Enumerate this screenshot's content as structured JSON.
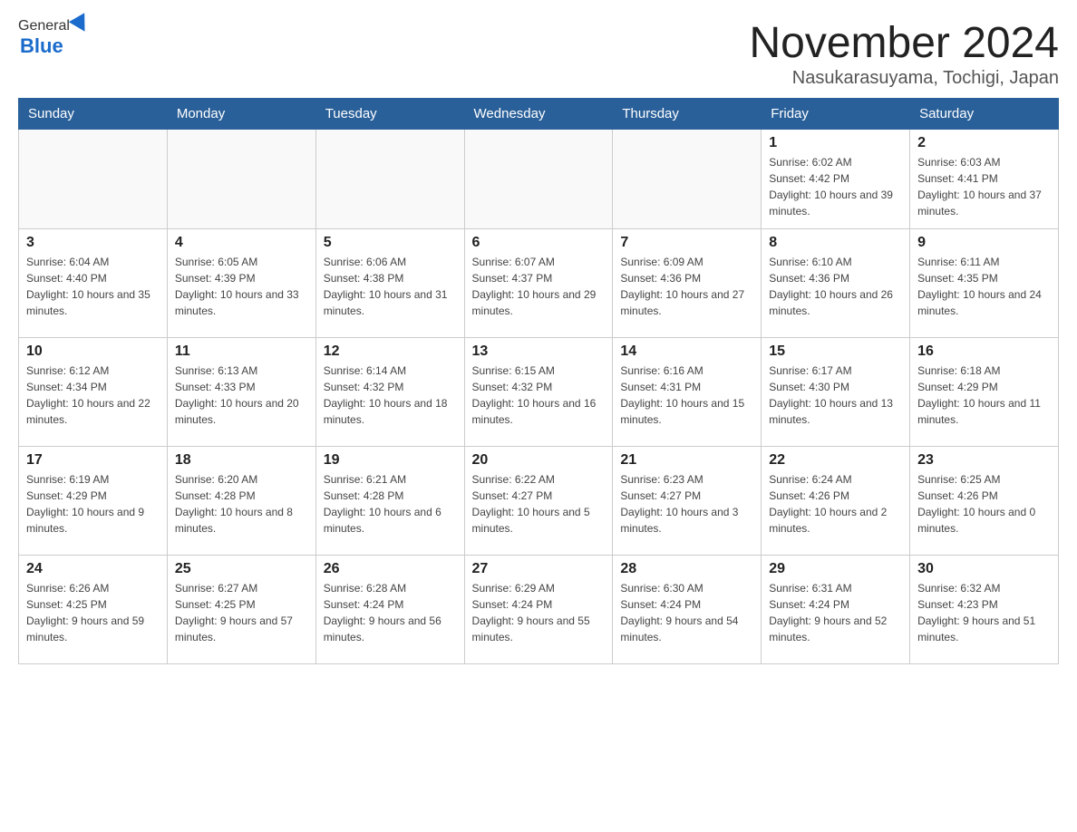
{
  "header": {
    "logo_general": "General",
    "logo_blue": "Blue",
    "main_title": "November 2024",
    "subtitle": "Nasukarasuyama, Tochigi, Japan"
  },
  "weekdays": [
    "Sunday",
    "Monday",
    "Tuesday",
    "Wednesday",
    "Thursday",
    "Friday",
    "Saturday"
  ],
  "weeks": [
    [
      {
        "day": "",
        "info": ""
      },
      {
        "day": "",
        "info": ""
      },
      {
        "day": "",
        "info": ""
      },
      {
        "day": "",
        "info": ""
      },
      {
        "day": "",
        "info": ""
      },
      {
        "day": "1",
        "info": "Sunrise: 6:02 AM\nSunset: 4:42 PM\nDaylight: 10 hours and 39 minutes."
      },
      {
        "day": "2",
        "info": "Sunrise: 6:03 AM\nSunset: 4:41 PM\nDaylight: 10 hours and 37 minutes."
      }
    ],
    [
      {
        "day": "3",
        "info": "Sunrise: 6:04 AM\nSunset: 4:40 PM\nDaylight: 10 hours and 35 minutes."
      },
      {
        "day": "4",
        "info": "Sunrise: 6:05 AM\nSunset: 4:39 PM\nDaylight: 10 hours and 33 minutes."
      },
      {
        "day": "5",
        "info": "Sunrise: 6:06 AM\nSunset: 4:38 PM\nDaylight: 10 hours and 31 minutes."
      },
      {
        "day": "6",
        "info": "Sunrise: 6:07 AM\nSunset: 4:37 PM\nDaylight: 10 hours and 29 minutes."
      },
      {
        "day": "7",
        "info": "Sunrise: 6:09 AM\nSunset: 4:36 PM\nDaylight: 10 hours and 27 minutes."
      },
      {
        "day": "8",
        "info": "Sunrise: 6:10 AM\nSunset: 4:36 PM\nDaylight: 10 hours and 26 minutes."
      },
      {
        "day": "9",
        "info": "Sunrise: 6:11 AM\nSunset: 4:35 PM\nDaylight: 10 hours and 24 minutes."
      }
    ],
    [
      {
        "day": "10",
        "info": "Sunrise: 6:12 AM\nSunset: 4:34 PM\nDaylight: 10 hours and 22 minutes."
      },
      {
        "day": "11",
        "info": "Sunrise: 6:13 AM\nSunset: 4:33 PM\nDaylight: 10 hours and 20 minutes."
      },
      {
        "day": "12",
        "info": "Sunrise: 6:14 AM\nSunset: 4:32 PM\nDaylight: 10 hours and 18 minutes."
      },
      {
        "day": "13",
        "info": "Sunrise: 6:15 AM\nSunset: 4:32 PM\nDaylight: 10 hours and 16 minutes."
      },
      {
        "day": "14",
        "info": "Sunrise: 6:16 AM\nSunset: 4:31 PM\nDaylight: 10 hours and 15 minutes."
      },
      {
        "day": "15",
        "info": "Sunrise: 6:17 AM\nSunset: 4:30 PM\nDaylight: 10 hours and 13 minutes."
      },
      {
        "day": "16",
        "info": "Sunrise: 6:18 AM\nSunset: 4:29 PM\nDaylight: 10 hours and 11 minutes."
      }
    ],
    [
      {
        "day": "17",
        "info": "Sunrise: 6:19 AM\nSunset: 4:29 PM\nDaylight: 10 hours and 9 minutes."
      },
      {
        "day": "18",
        "info": "Sunrise: 6:20 AM\nSunset: 4:28 PM\nDaylight: 10 hours and 8 minutes."
      },
      {
        "day": "19",
        "info": "Sunrise: 6:21 AM\nSunset: 4:28 PM\nDaylight: 10 hours and 6 minutes."
      },
      {
        "day": "20",
        "info": "Sunrise: 6:22 AM\nSunset: 4:27 PM\nDaylight: 10 hours and 5 minutes."
      },
      {
        "day": "21",
        "info": "Sunrise: 6:23 AM\nSunset: 4:27 PM\nDaylight: 10 hours and 3 minutes."
      },
      {
        "day": "22",
        "info": "Sunrise: 6:24 AM\nSunset: 4:26 PM\nDaylight: 10 hours and 2 minutes."
      },
      {
        "day": "23",
        "info": "Sunrise: 6:25 AM\nSunset: 4:26 PM\nDaylight: 10 hours and 0 minutes."
      }
    ],
    [
      {
        "day": "24",
        "info": "Sunrise: 6:26 AM\nSunset: 4:25 PM\nDaylight: 9 hours and 59 minutes."
      },
      {
        "day": "25",
        "info": "Sunrise: 6:27 AM\nSunset: 4:25 PM\nDaylight: 9 hours and 57 minutes."
      },
      {
        "day": "26",
        "info": "Sunrise: 6:28 AM\nSunset: 4:24 PM\nDaylight: 9 hours and 56 minutes."
      },
      {
        "day": "27",
        "info": "Sunrise: 6:29 AM\nSunset: 4:24 PM\nDaylight: 9 hours and 55 minutes."
      },
      {
        "day": "28",
        "info": "Sunrise: 6:30 AM\nSunset: 4:24 PM\nDaylight: 9 hours and 54 minutes."
      },
      {
        "day": "29",
        "info": "Sunrise: 6:31 AM\nSunset: 4:24 PM\nDaylight: 9 hours and 52 minutes."
      },
      {
        "day": "30",
        "info": "Sunrise: 6:32 AM\nSunset: 4:23 PM\nDaylight: 9 hours and 51 minutes."
      }
    ]
  ]
}
